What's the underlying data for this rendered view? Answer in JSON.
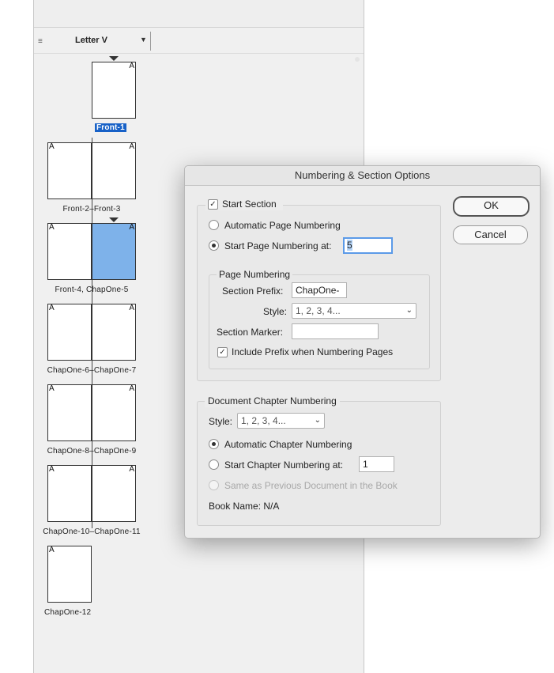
{
  "pages_panel": {
    "master_name": "Letter V",
    "page_marker": "A",
    "spreads": [
      {
        "label": "Front-1"
      },
      {
        "label": "Front-2–Front-3"
      },
      {
        "label": "Front-4, ChapOne-5"
      },
      {
        "label": "ChapOne-6–ChapOne-7"
      },
      {
        "label": "ChapOne-8–ChapOne-9"
      },
      {
        "label": "ChapOne-10–ChapOne-11"
      },
      {
        "label": "ChapOne-12"
      }
    ]
  },
  "dialog": {
    "title": "Numbering & Section Options",
    "ok_label": "OK",
    "cancel_label": "Cancel",
    "start_section": {
      "label": "Start Section",
      "checked": true
    },
    "automatic_page_numbering": {
      "label": "Automatic Page Numbering",
      "selected": false
    },
    "start_page_numbering": {
      "label": "Start Page Numbering at:",
      "selected": true,
      "value": "5"
    },
    "page_numbering": {
      "heading": "Page Numbering",
      "section_prefix_label": "Section Prefix:",
      "section_prefix_value": "ChapOne-",
      "style_label": "Style:",
      "style_value": "1, 2, 3, 4...",
      "section_marker_label": "Section Marker:",
      "section_marker_value": "",
      "include_prefix_label": "Include Prefix when Numbering Pages",
      "include_prefix_checked": true
    },
    "chapter_numbering": {
      "heading": "Document Chapter Numbering",
      "style_label": "Style:",
      "style_value": "1, 2, 3, 4...",
      "automatic_label": "Automatic Chapter Numbering",
      "start_label": "Start Chapter Numbering at:",
      "start_value": "1",
      "same_as_previous_label": "Same as Previous Document in the Book",
      "book_name": "Book Name: N/A"
    }
  },
  "colors": {
    "selection_blue": "#1761c7",
    "selected_page": "#7eb2ea",
    "focus_ring": "#5b9ae8"
  },
  "icons": [
    "panel-grip-icon",
    "dropdown-caret-icon",
    "checkbox-check-icon",
    "chevron-down-icon"
  ]
}
